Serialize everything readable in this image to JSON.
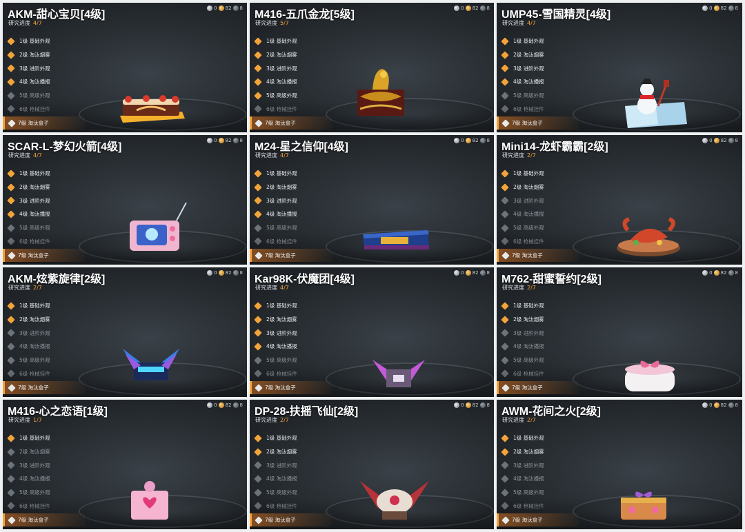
{
  "currency": {
    "a": "0",
    "b": "82",
    "c": "8"
  },
  "progress_label": "研究进度",
  "level_names": [
    "1级 基础外观",
    "2级 淘汰烟雾",
    "3级 进阶外观",
    "4级 淘汰播报",
    "5级 高级外观",
    "6级 枪械挂件"
  ],
  "box_label": "7级 淘汰盒子",
  "panels": [
    {
      "title": "AKM-甜心宝贝[4级]",
      "progress": "4/7",
      "unlocked": 4,
      "item": "cake-box-icon"
    },
    {
      "title": "M416-五爪金龙[5级]",
      "progress": "5/7",
      "unlocked": 5,
      "item": "golden-dragon-box-icon"
    },
    {
      "title": "UMP45-雪国精灵[4级]",
      "progress": "4/7",
      "unlocked": 4,
      "item": "snowman-box-icon"
    },
    {
      "title": "SCAR-L-梦幻火箭[4级]",
      "progress": "4/7",
      "unlocked": 4,
      "item": "pink-radio-box-icon"
    },
    {
      "title": "M24-星之信仰[4级]",
      "progress": "4/7",
      "unlocked": 4,
      "item": "star-case-box-icon"
    },
    {
      "title": "Mini14-龙虾霸霸[2级]",
      "progress": "2/7",
      "unlocked": 2,
      "item": "lobster-plate-box-icon"
    },
    {
      "title": "AKM-炫紫旋律[2级]",
      "progress": "2/7",
      "unlocked": 2,
      "item": "neon-winged-box-icon"
    },
    {
      "title": "Kar98K-伏魔团[4级]",
      "progress": "4/7",
      "unlocked": 4,
      "item": "purple-winged-box-icon"
    },
    {
      "title": "M762-甜蜜誓约[2级]",
      "progress": "2/7",
      "unlocked": 2,
      "item": "ribbon-gift-box-icon"
    },
    {
      "title": "M416-心之恋语[1级]",
      "progress": "1/7",
      "unlocked": 1,
      "item": "heart-chest-box-icon"
    },
    {
      "title": "DP-28-扶摇飞仙[2级]",
      "progress": "2/7",
      "unlocked": 2,
      "item": "crimson-wing-box-icon"
    },
    {
      "title": "AWM-花间之火[2级]",
      "progress": "2/7",
      "unlocked": 2,
      "item": "flower-chest-box-icon"
    }
  ]
}
